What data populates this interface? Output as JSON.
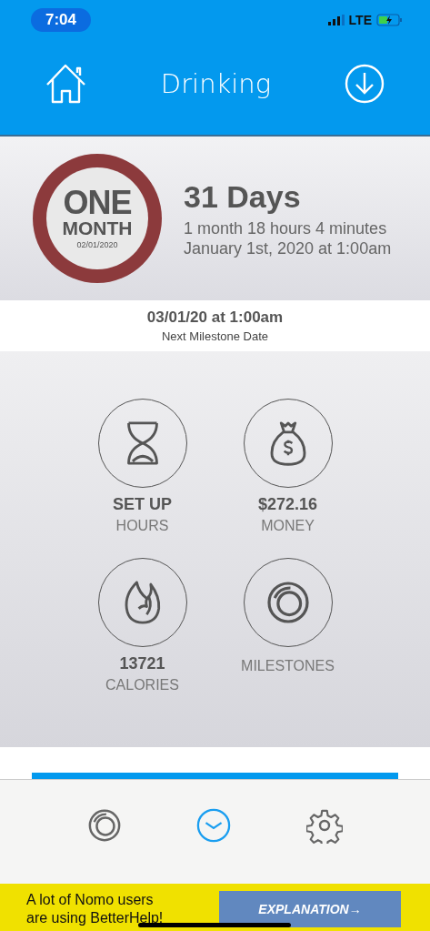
{
  "status_bar": {
    "time": "7:04",
    "network": "LTE"
  },
  "header": {
    "title": "Drinking"
  },
  "streak": {
    "badge": {
      "top": "ONE",
      "bottom": "MONTH",
      "date": "02/01/2020"
    },
    "days": "31 Days",
    "duration": "1 month 18 hours 4 minutes",
    "start": "January 1st, 2020 at 1:00am"
  },
  "next_milestone": {
    "date": "03/01/20 at 1:00am",
    "label": "Next Milestone Date"
  },
  "stats": [
    {
      "kind": "hours",
      "value": "SET UP",
      "label": "HOURS"
    },
    {
      "kind": "money",
      "value": "$272.16",
      "label": "MONEY"
    },
    {
      "kind": "calories",
      "value": "13721",
      "label": "CALORIES"
    },
    {
      "kind": "milestones",
      "label": "MILESTONES"
    }
  ],
  "tab_bar": [
    {
      "kind": "milestones",
      "selected": false
    },
    {
      "kind": "clock",
      "selected": true
    },
    {
      "kind": "settings",
      "selected": false
    }
  ],
  "ad": {
    "text": "A lot of Nomo users are using BetterHelp!",
    "button": "EXPLANATION→"
  }
}
